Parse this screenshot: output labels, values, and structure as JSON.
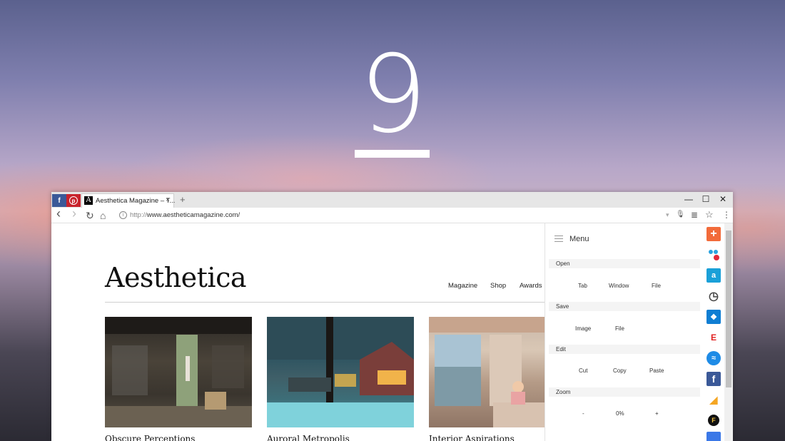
{
  "hero": {
    "number": "9"
  },
  "browser": {
    "pinned_tabs": [
      {
        "icon": "facebook-icon",
        "glyph": "f",
        "color": "#3b5998"
      },
      {
        "icon": "pinterest-icon",
        "glyph": "p",
        "color": "#c8232c"
      }
    ],
    "active_tab": {
      "favicon": "A",
      "title": "Aesthetica  Magazine – T...",
      "close": "×"
    },
    "new_tab": "+",
    "window_controls": {
      "minimize": "—",
      "maximize": "☐",
      "close": "✕"
    },
    "toolbar": {
      "back": "‹",
      "forward": "›",
      "reload": "↻",
      "home": "⌂",
      "url_prefix": "http://",
      "url_host": "www.aestheticamagazine.com/",
      "info": "i",
      "dropdown": "▾",
      "mic": "🎙",
      "reader": "≣",
      "star": "☆",
      "more": "⋮"
    }
  },
  "site": {
    "logo": "Aesthetica",
    "nav": [
      "Magazine",
      "Shop",
      "Awards"
    ],
    "cards": [
      {
        "title": "Obscure Perceptions"
      },
      {
        "title": "Auroral Metropolis"
      },
      {
        "title": "Interior Aspirations"
      }
    ]
  },
  "menu": {
    "title": "Menu",
    "sections": [
      {
        "label": "Open",
        "items": [
          "Tab",
          "Window",
          "File"
        ]
      },
      {
        "label": "Save",
        "items": [
          "Image",
          "File"
        ]
      },
      {
        "label": "Edit",
        "items": [
          "Cut",
          "Copy",
          "Paste"
        ]
      },
      {
        "label": "Zoom",
        "items": [
          "-",
          "0%",
          "+"
        ]
      }
    ]
  },
  "extensions": [
    {
      "icon": "plus-extension-icon",
      "glyph": "+",
      "color": "#f26b3a"
    },
    {
      "icon": "dots-extension-icon",
      "glyph": "",
      "color": "#ffffff"
    },
    {
      "icon": "a-extension-icon",
      "glyph": "a",
      "color": "#1aa0d8"
    },
    {
      "icon": "clock-extension-icon",
      "glyph": "◷",
      "color": "#ffffff"
    },
    {
      "icon": "dropbox-icon",
      "glyph": "❖",
      "color": "#0f7ed3"
    },
    {
      "icon": "easy-extension-icon",
      "glyph": "E",
      "color": "#ffffff"
    },
    {
      "icon": "messenger-icon",
      "glyph": "≈",
      "color": "#1e8be6"
    },
    {
      "icon": "facebook-extension-icon",
      "glyph": "f",
      "color": "#3b5998"
    },
    {
      "icon": "tag-extension-icon",
      "glyph": "◢",
      "color": "#ffffff"
    },
    {
      "icon": "f-circle-extension-icon",
      "glyph": "F",
      "color": "#ffffff"
    },
    {
      "icon": "docs-icon",
      "glyph": "",
      "color": "#3b78e7"
    }
  ]
}
